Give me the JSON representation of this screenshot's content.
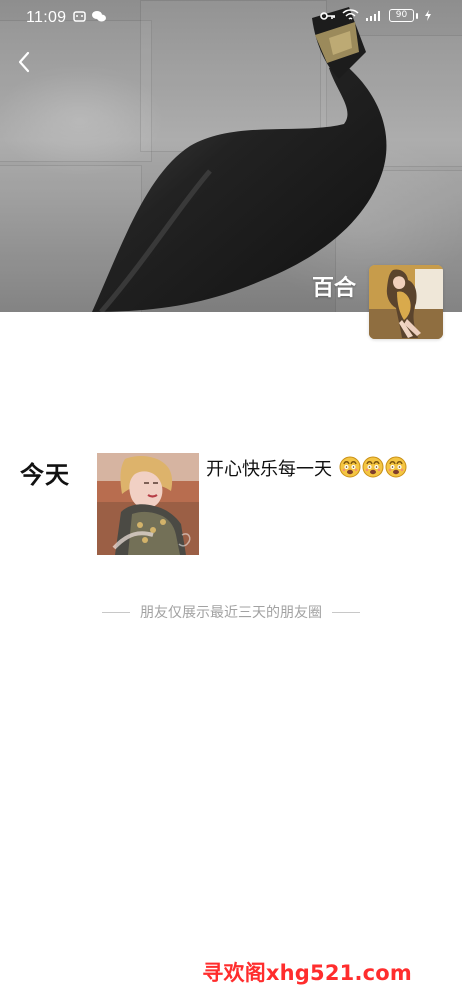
{
  "status_bar": {
    "time": "11:09",
    "battery": "90"
  },
  "profile": {
    "name": "百合"
  },
  "post": {
    "date_label": "今天",
    "text": "开心快乐每一天",
    "emoji": [
      "smiling-face-emoji",
      "smiling-face-emoji",
      "smiling-face-emoji"
    ]
  },
  "notice": {
    "text": "朋友仅展示最近三天的朋友圈"
  },
  "watermark": {
    "text": "寻欢阁xhg521.com"
  },
  "icons": {
    "back": "chevron-left-icon",
    "key": "key-icon",
    "wifi": "wifi-icon",
    "signal": "signal-icon",
    "battery": "battery-icon",
    "charging": "charging-icon",
    "notification_a": "notification-icon",
    "notification_b": "wechat-icon"
  },
  "colors": {
    "accent_red": "#ff2d2d",
    "text_primary": "#111111",
    "text_muted": "#a2a2a2"
  }
}
